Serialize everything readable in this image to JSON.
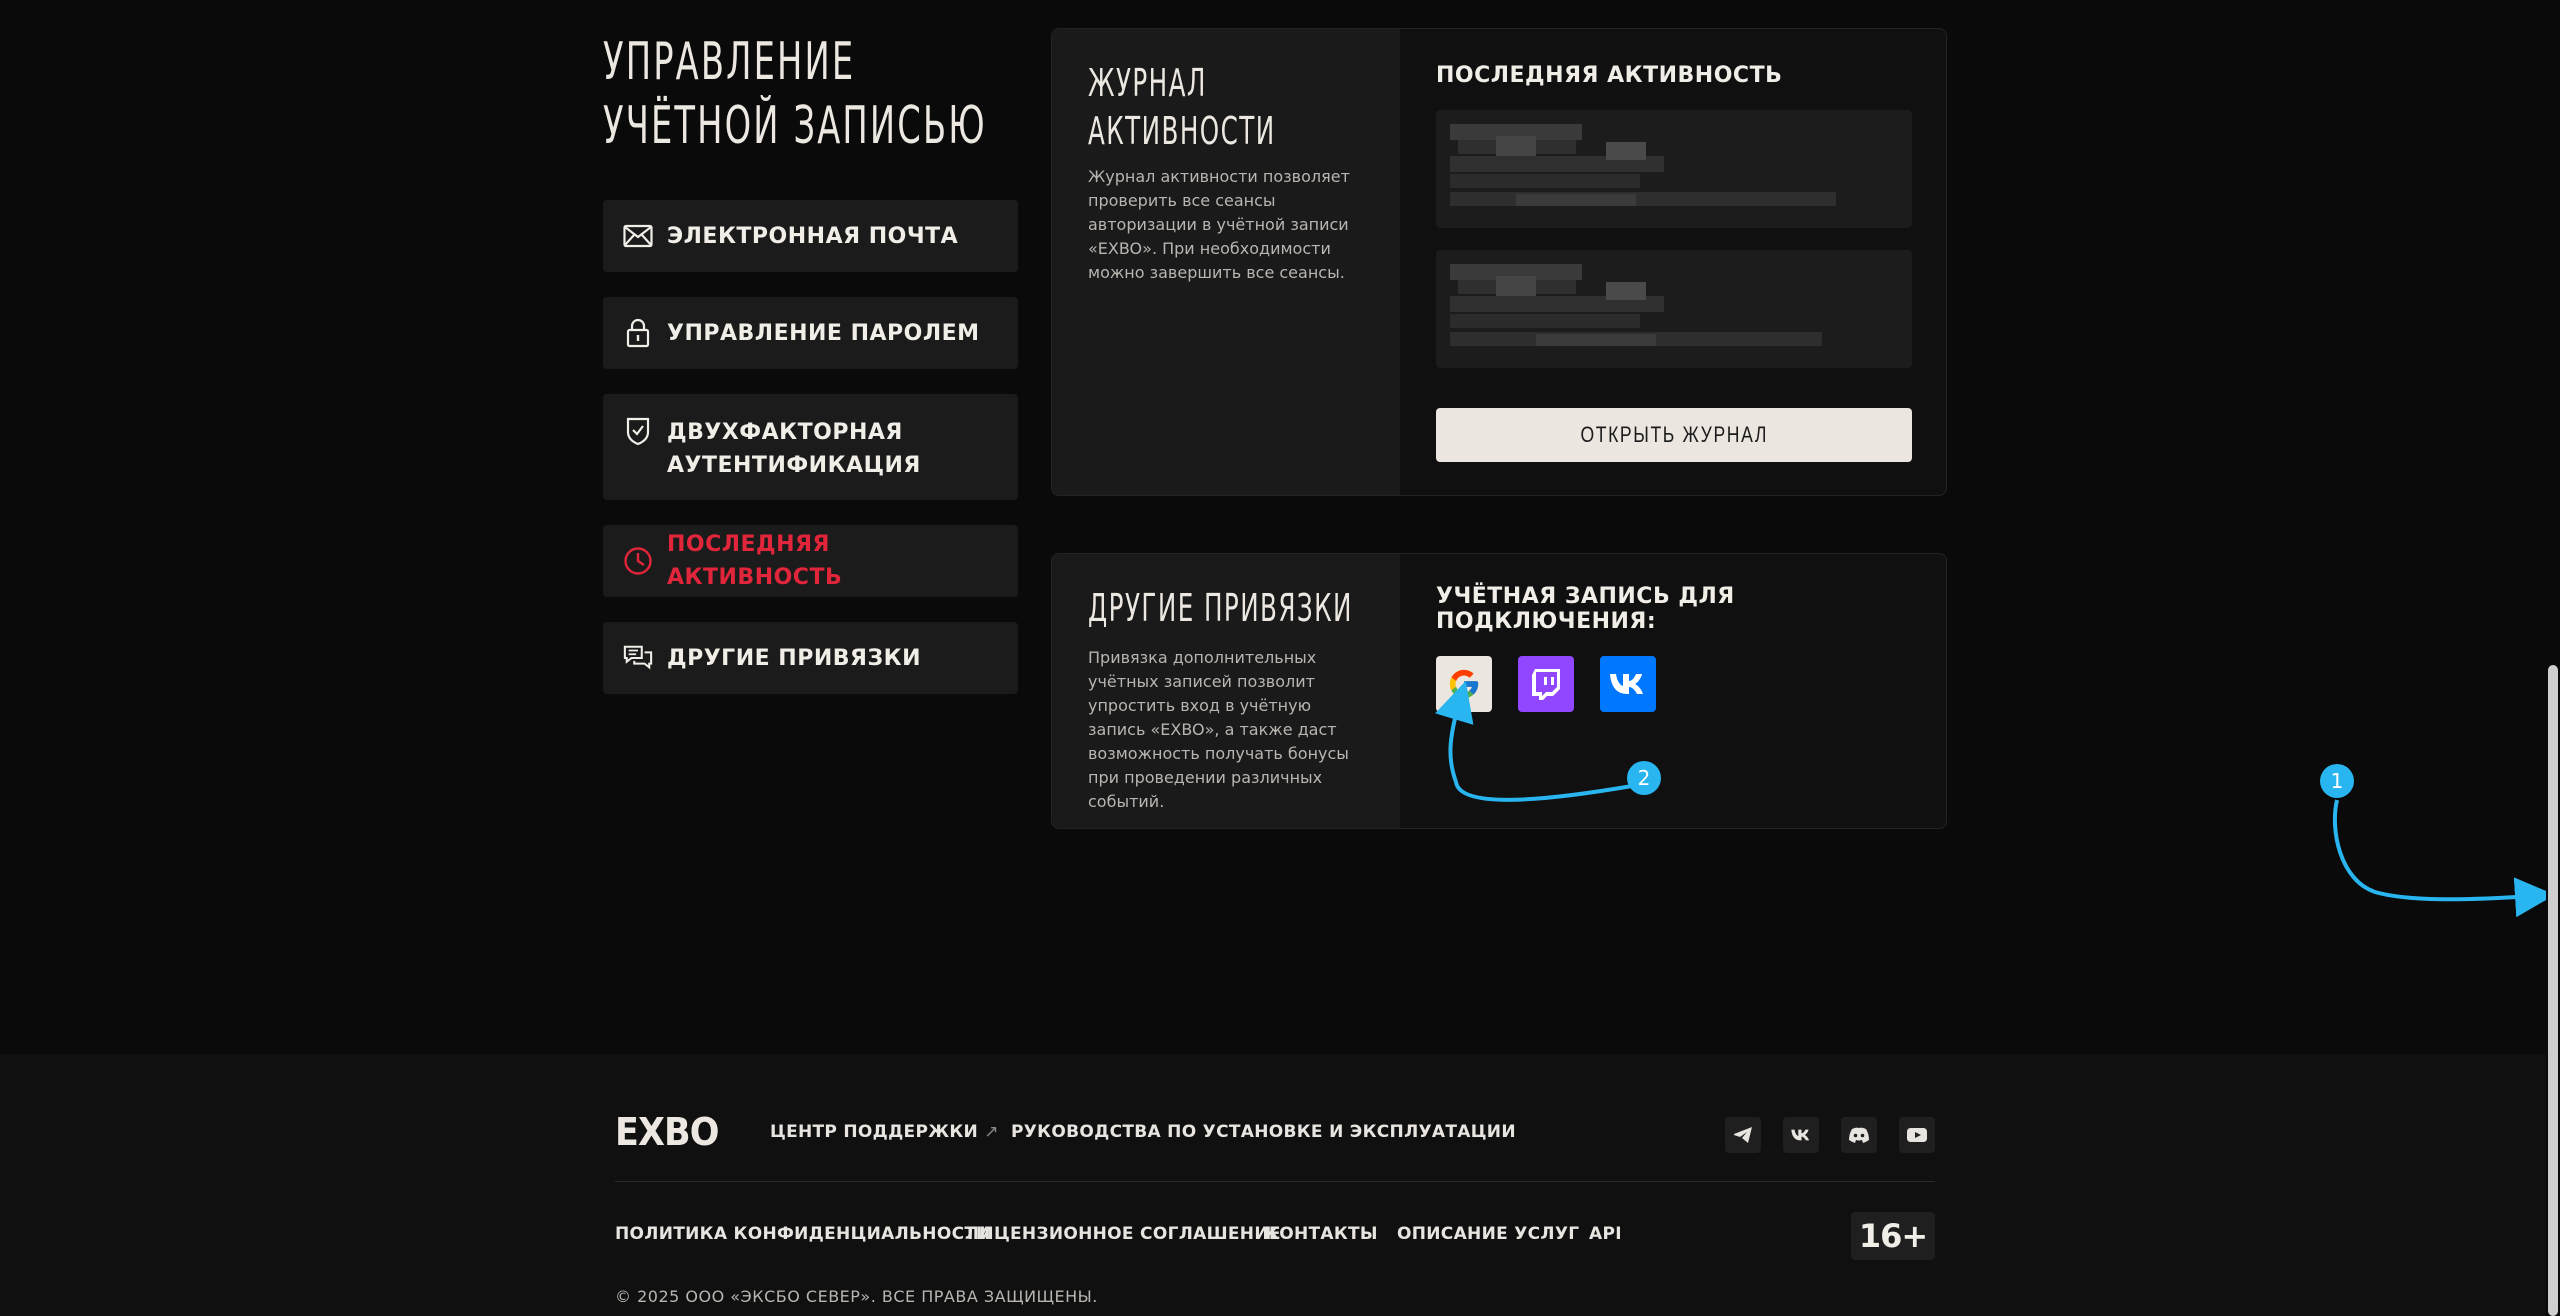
{
  "page": {
    "title_line1": "УПРАВЛЕНИЕ",
    "title_line2": "УЧЁТНОЙ ЗАПИСЬЮ"
  },
  "nav": {
    "items": [
      {
        "label": "ЭЛЕКТРОННАЯ ПОЧТА",
        "icon": "mail-icon"
      },
      {
        "label": "УПРАВЛЕНИЕ ПАРОЛЕМ",
        "icon": "lock-icon"
      },
      {
        "label_line1": "ДВУХФАКТОРНАЯ",
        "label_line2": "АУТЕНТИФИКАЦИЯ",
        "icon": "shield-check-icon"
      },
      {
        "label": "ПОСЛЕДНЯЯ АКТИВНОСТЬ",
        "icon": "clock-icon",
        "active": true
      },
      {
        "label": "ДРУГИЕ ПРИВЯЗКИ",
        "icon": "chat-icon"
      }
    ],
    "active_color": "#e1253a"
  },
  "activity_card": {
    "title_line1": "ЖУРНАЛ",
    "title_line2": "АКТИВНОСТИ",
    "description": "Журнал активности позволяет проверить все сеансы авторизации в учётной записи «EXBO». При необходимости можно завершить все сеансы.",
    "right_title": "ПОСЛЕДНЯЯ АКТИВНОСТЬ",
    "open_button": "ОТКРЫТЬ ЖУРНАЛ"
  },
  "links_card": {
    "title": "ДРУГИЕ ПРИВЯЗКИ",
    "description": "Привязка дополнительных учётных записей позволит упростить вход в учётную запись «EXBO», а также даст возможность получать бонусы при проведении различных событий.",
    "right_title": "УЧЁТНАЯ ЗАПИСЬ ДЛЯ ПОДКЛЮЧЕНИЯ:",
    "providers": [
      {
        "name": "google",
        "icon": "google-icon",
        "bg": "#ebe6e0"
      },
      {
        "name": "twitch",
        "icon": "twitch-icon",
        "bg": "#9146ff"
      },
      {
        "name": "vk",
        "icon": "vk-icon",
        "bg": "#0077ff"
      }
    ]
  },
  "annotations": {
    "badge1": "1",
    "badge2": "2",
    "color": "#29b6f0"
  },
  "footer": {
    "logo": "EXBO",
    "support_link": "ЦЕНТР ПОДДЕРЖКИ",
    "support_arrow": "↗",
    "guides_link": "РУКОВОДСТВА ПО УСТАНОВКЕ И ЭКСПЛУАТАЦИИ",
    "bottom_links": [
      "ПОЛИТИКА КОНФИДЕНЦИАЛЬНОСТИ",
      "ЛИЦЕНЗИОННОЕ СОГЛАШЕНИЕ",
      "КОНТАКТЫ",
      "ОПИСАНИЕ УСЛУГ",
      "API"
    ],
    "copyright": "© 2025 ООО «ЭКСБО СЕВЕР». ВСЕ ПРАВА ЗАЩИЩЕНЫ.",
    "age_rating": "16+",
    "social_icons": [
      "telegram-icon",
      "vk-icon",
      "discord-icon",
      "youtube-icon"
    ]
  }
}
